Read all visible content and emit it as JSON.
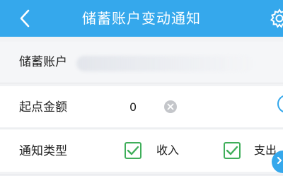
{
  "header": {
    "title": "储蓄账户变动通知",
    "back_icon": "chevron-left-icon",
    "settings_icon": "gear-icon",
    "color": "#35a8ec"
  },
  "account": {
    "label": "储蓄账户"
  },
  "amount": {
    "label": "起点金额",
    "value": "0",
    "clear_icon": "clear-circle-icon"
  },
  "notify_type": {
    "label": "通知类型",
    "options": [
      {
        "label": "收入",
        "checked": true
      },
      {
        "label": "支出",
        "checked": true
      }
    ],
    "check_color": "#3fae5a"
  }
}
